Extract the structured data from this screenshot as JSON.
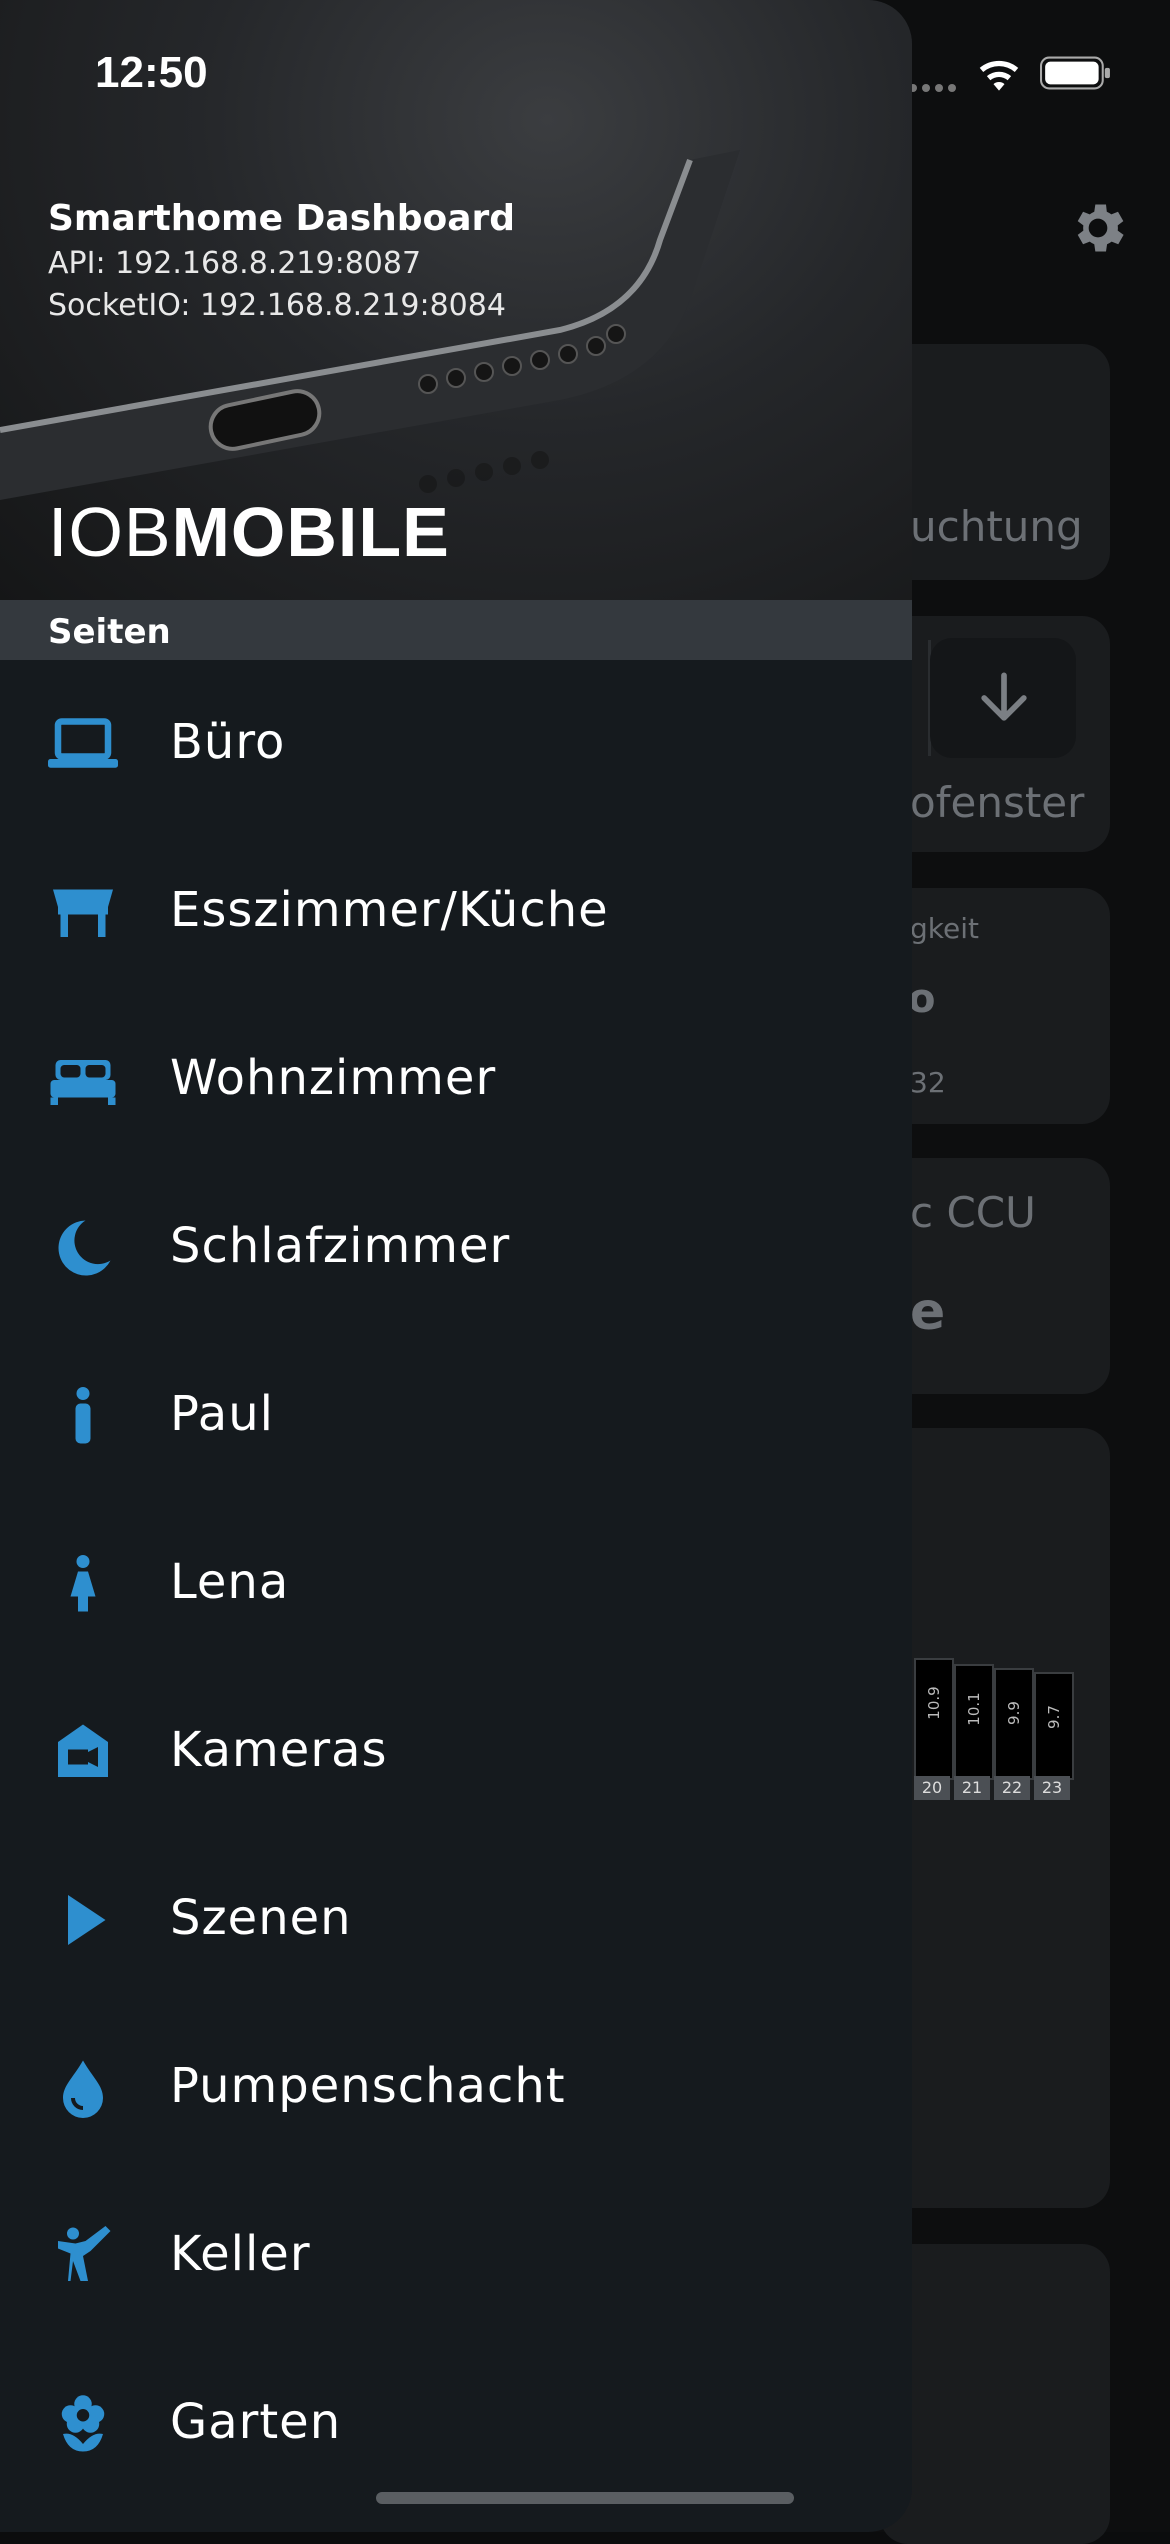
{
  "status_bar": {
    "time": "12:50"
  },
  "drawer": {
    "app_title": "Smarthome Dashboard",
    "api": "API: 192.168.8.219:8087",
    "socketio": "SocketIO: 192.168.8.219:8084",
    "brand_light": "IOB",
    "brand_bold": "MOBILE",
    "section": "Seiten",
    "items": [
      {
        "label": "Büro",
        "icon": "laptop-icon"
      },
      {
        "label": "Esszimmer/Küche",
        "icon": "table-icon"
      },
      {
        "label": "Wohnzimmer",
        "icon": "bed-icon"
      },
      {
        "label": "Schlafzimmer",
        "icon": "moon-icon"
      },
      {
        "label": "Paul",
        "icon": "male-icon"
      },
      {
        "label": "Lena",
        "icon": "female-icon"
      },
      {
        "label": "Kameras",
        "icon": "camera-house-icon"
      },
      {
        "label": "Szenen",
        "icon": "play-icon"
      },
      {
        "label": "Pumpenschacht",
        "icon": "water-drop-icon"
      },
      {
        "label": "Keller",
        "icon": "karate-icon"
      },
      {
        "label": "Garten",
        "icon": "flower-icon"
      }
    ],
    "accent_color": "#2e8fcf"
  },
  "background": {
    "card1_text": "uchtung",
    "card2_text": "ofenster",
    "card3_label": "gkeit",
    "card3_value": "o",
    "card3_sub": "32",
    "card4_label": "c CCU",
    "card4_value": "e",
    "mini_chart": {
      "values": [
        "10.9",
        "10.1",
        "9.9",
        "9.7"
      ],
      "labels": [
        "20",
        "21",
        "22",
        "23"
      ]
    }
  }
}
